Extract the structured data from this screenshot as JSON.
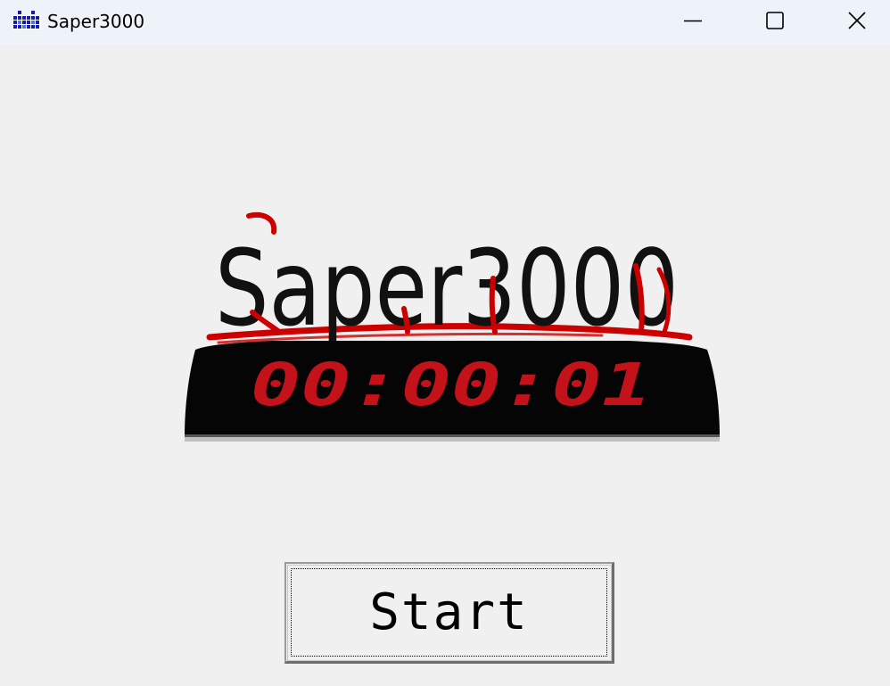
{
  "window": {
    "title": "Saper3000",
    "icon": "minefield-grid-icon",
    "controls": {
      "minimize": "minimize-icon",
      "maximize": "maximize-icon",
      "close": "close-icon"
    }
  },
  "logo": {
    "title": "Saper3000",
    "timer": "00:00:01",
    "colors": {
      "title_text": "#111111",
      "accent_red": "#cc0000",
      "timer_bg": "#000000",
      "timer_digits": "#c4121a"
    }
  },
  "start_button": {
    "label": "Start"
  },
  "colors": {
    "window_bg": "#f0f0f0",
    "titlebar_bg": "#eef2f9",
    "icon_blue": "#1a1aa8"
  }
}
